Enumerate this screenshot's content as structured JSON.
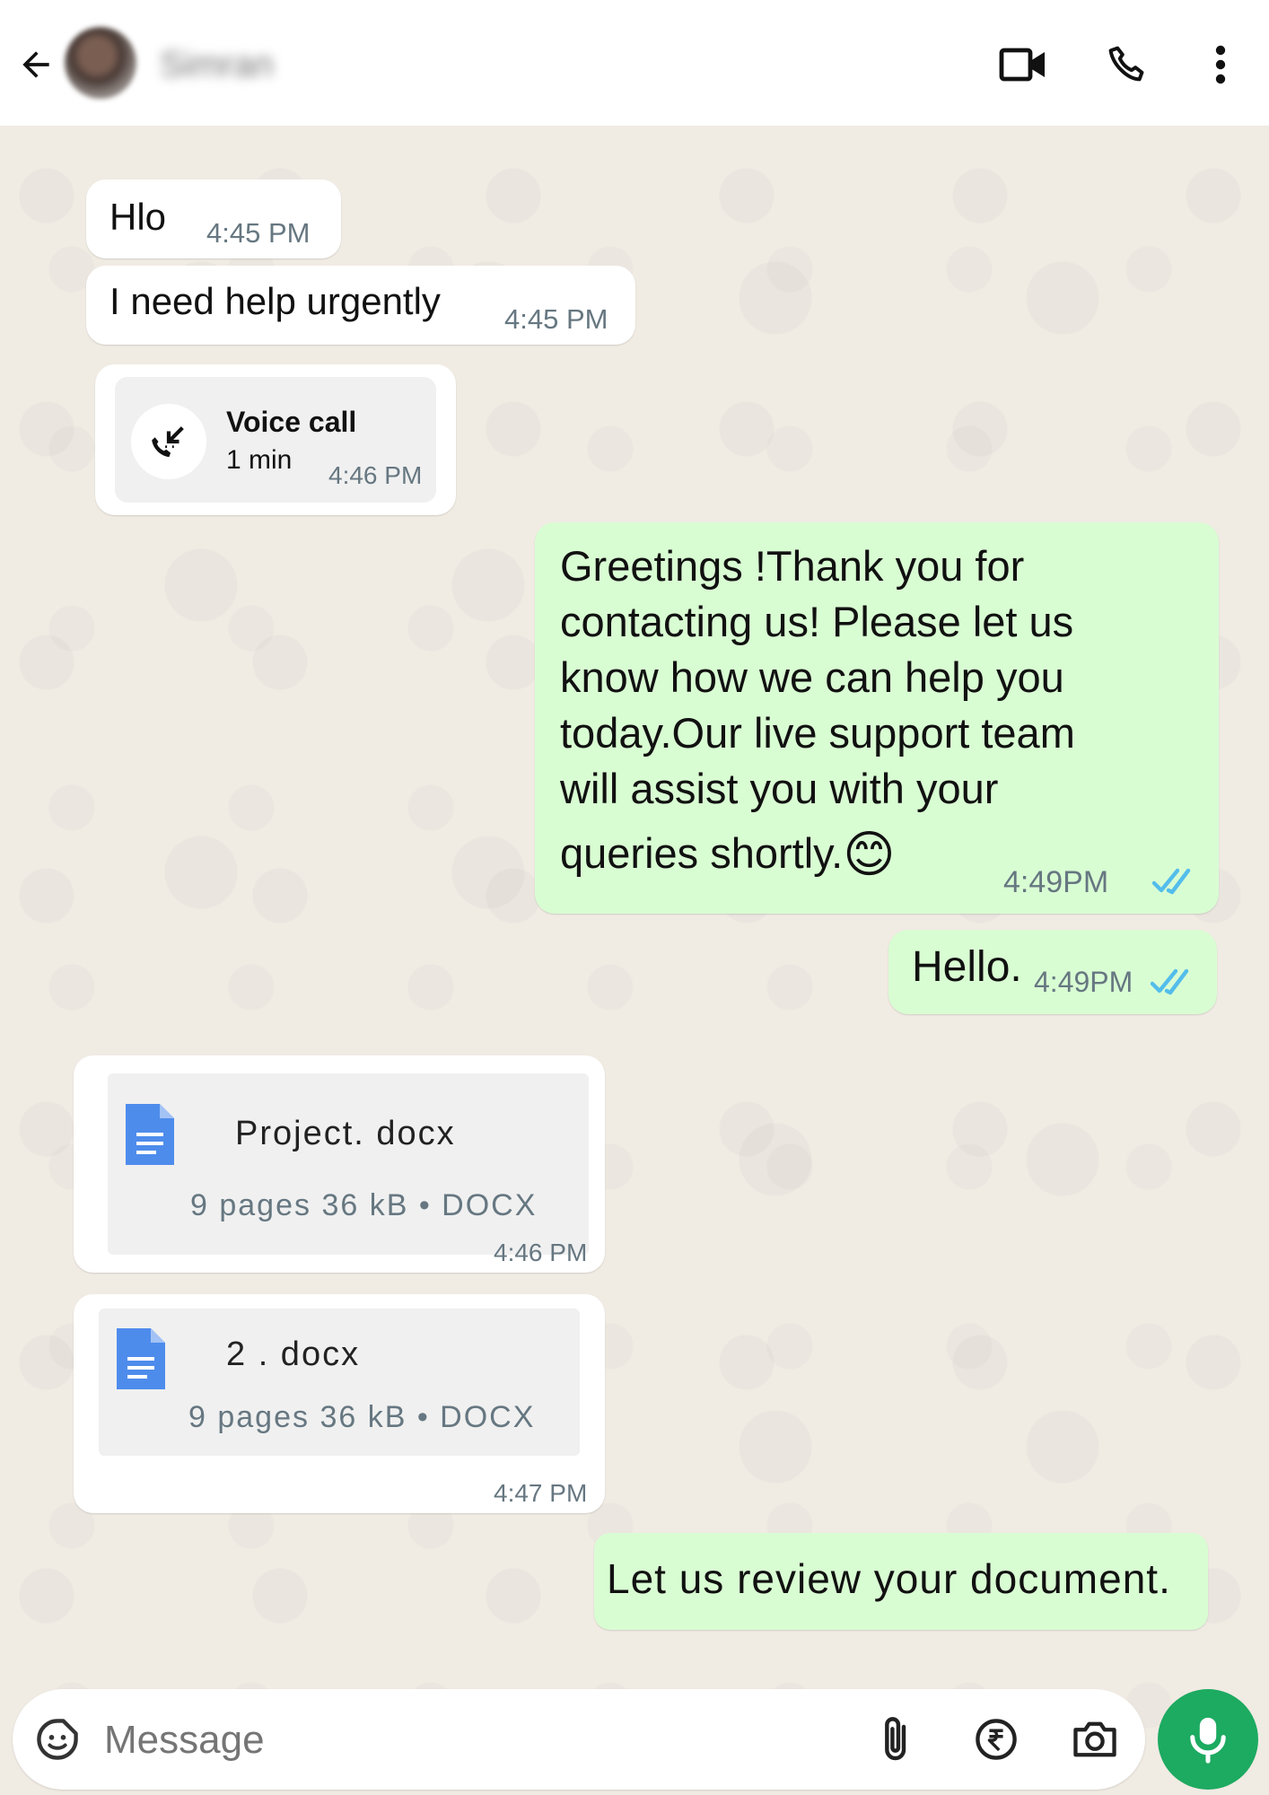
{
  "header": {
    "contact_name": "Simran",
    "icons": [
      "back-arrow-icon",
      "video-call-icon",
      "phone-icon",
      "more-vertical-icon"
    ]
  },
  "messages": [
    {
      "direction": "incoming",
      "text": "Hlo",
      "time": "4:45 PM"
    },
    {
      "direction": "incoming",
      "text": "I need help urgently",
      "time": "4:45 PM"
    },
    {
      "direction": "incoming",
      "type": "voice-call",
      "title": "Voice call",
      "duration": "1 min",
      "time": "4:46 PM"
    },
    {
      "direction": "outgoing",
      "lines": [
        "Greetings !Thank you for",
        "contacting us! Please let us",
        "know how we can help you",
        "today.Our live support team",
        "will assist you with your",
        "queries shortly."
      ],
      "emoji": "😊",
      "time": "4:49PM",
      "status": "read"
    },
    {
      "direction": "outgoing",
      "text": "Hello.",
      "time": "4:49PM",
      "status": "read"
    },
    {
      "direction": "incoming",
      "type": "document",
      "name": "Project. docx",
      "meta": "9 pages 36 kB • DOCX",
      "time": "4:46 PM"
    },
    {
      "direction": "incoming",
      "type": "document",
      "name": "2 . docx",
      "meta": "9 pages 36 kB • DOCX",
      "time": "4:47 PM"
    },
    {
      "direction": "outgoing",
      "text": "Let us review your document."
    }
  ],
  "composer": {
    "placeholder": "Message",
    "icons": [
      "sticker-icon",
      "attach-icon",
      "rupee-payment-icon",
      "camera-icon",
      "mic-icon"
    ]
  },
  "colors": {
    "incoming_bubble": "#ffffff",
    "outgoing_bubble": "#d9fdd3",
    "read_ticks": "#53bdeb",
    "mic_button": "#1daa61"
  }
}
